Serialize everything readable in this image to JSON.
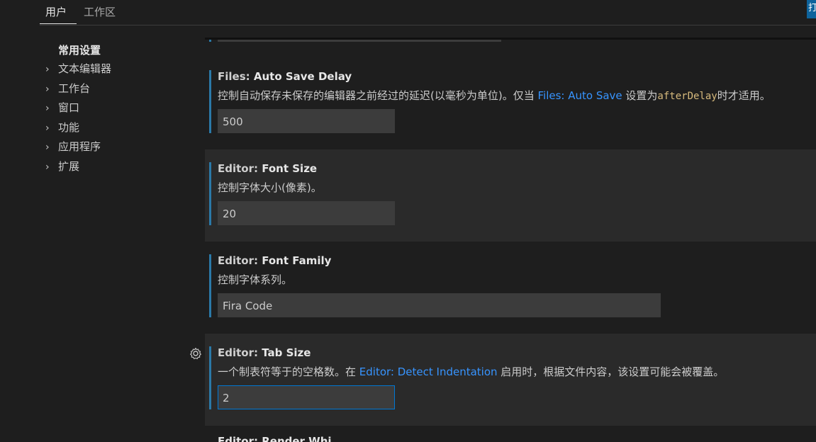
{
  "tabs": [
    {
      "label": "用户",
      "active": true
    },
    {
      "label": "工作区",
      "active": false
    }
  ],
  "corner_button": {
    "label": "打"
  },
  "toc": {
    "heading": "常用设置",
    "items": [
      "文本编辑器",
      "工作台",
      "窗口",
      "功能",
      "应用程序",
      "扩展"
    ]
  },
  "settings": [
    {
      "category": "Files: ",
      "key": "Auto Save Delay",
      "desc_parts": {
        "pre": "控制自动保存未保存的编辑器之前经过的延迟(以毫秒为单位)。仅当 ",
        "link": "Files: Auto Save",
        "mid": " 设置为",
        "code": "afterDelay",
        "post": "时才适用。"
      },
      "value": "500"
    },
    {
      "category": "Editor: ",
      "key": "Font Size",
      "description": "控制字体大小(像素)。",
      "value": "20"
    },
    {
      "category": "Editor: ",
      "key": "Font Family",
      "description": "控制字体系列。",
      "value": "Fira Code"
    },
    {
      "category": "Editor: ",
      "key": "Tab Size",
      "desc_parts": {
        "pre": "一个制表符等于的空格数。在 ",
        "link": "Editor: Detect Indentation",
        "post": " 启用时，根据文件内容，该设置可能会被覆盖。"
      },
      "value": "2"
    }
  ],
  "partial_next_title": "Editor: Render Whi...",
  "colors": {
    "accent": "#0078d4",
    "link": "#3794ff",
    "modified_bar": "#2b79a8"
  },
  "icons": {
    "settings_gear": "gear-icon",
    "chevron": "chevron-right-icon"
  }
}
